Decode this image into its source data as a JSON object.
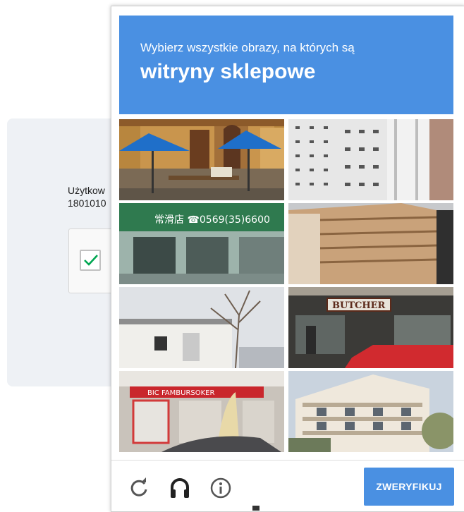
{
  "background": {
    "user_label": "Użytkow",
    "user_id": "1801010"
  },
  "challenge": {
    "prompt": "Wybierz wszystkie obrazy, na których są",
    "target": "witryny sklepowe",
    "tile_texts": {
      "phone_sign": "常滑店 ☎0569(35)6600",
      "butcher_sign": "BUTCHER",
      "shop_banner": "BIC FAMBURSOKER"
    }
  },
  "footer": {
    "reload_icon": "reload-icon",
    "audio_icon": "headphones-icon",
    "info_icon": "info-icon",
    "verify_label": "ZWERYFIKUJ"
  },
  "colors": {
    "accent": "#4a90e2",
    "check_green": "#00a651"
  }
}
